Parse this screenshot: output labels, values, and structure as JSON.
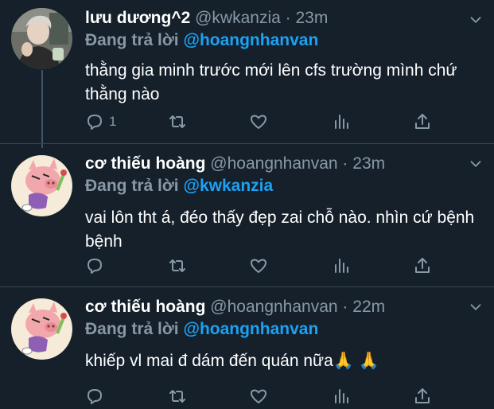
{
  "tweets": [
    {
      "name": "lưu dương^2",
      "handle": "@kwkanzia",
      "dot": "·",
      "time": "23m",
      "replying_prefix": "Đang trả lời",
      "replying_to": "@hoangnhanvan",
      "text": "thằng gia minh trước mới lên cfs trường mình chứ thằng nào",
      "reply_count": "1",
      "avatar": "photo-avatar"
    },
    {
      "name": "cơ thiếu hoàng",
      "handle": "@hoangnhanvan",
      "dot": "·",
      "time": "23m",
      "replying_prefix": "Đang trả lời",
      "replying_to": "@kwkanzia",
      "text": "vai lôn tht á, đéo thấy đẹp zai chỗ nào. nhìn cứ bệnh bệnh",
      "reply_count": "",
      "avatar": "pig-cartoon-avatar"
    },
    {
      "name": "cơ thiếu hoàng",
      "handle": "@hoangnhanvan",
      "dot": "·",
      "time": "22m",
      "replying_prefix": "Đang trả lời",
      "replying_to": "@hoangnhanvan",
      "text": "khiếp vl mai đ dám đến quán nữa🙏 🙏",
      "reply_count": "",
      "avatar": "pig-cartoon-avatar"
    }
  ],
  "icons": {
    "reply": "reply-icon",
    "retweet": "retweet-icon",
    "like": "heart-icon",
    "stats": "analytics-icon",
    "share": "share-icon",
    "more": "chevron-down-icon"
  },
  "colors": {
    "background": "#15202b",
    "text": "#ffffff",
    "secondary": "#8899a6",
    "accent": "#1da1f2",
    "divider": "#38444d"
  }
}
